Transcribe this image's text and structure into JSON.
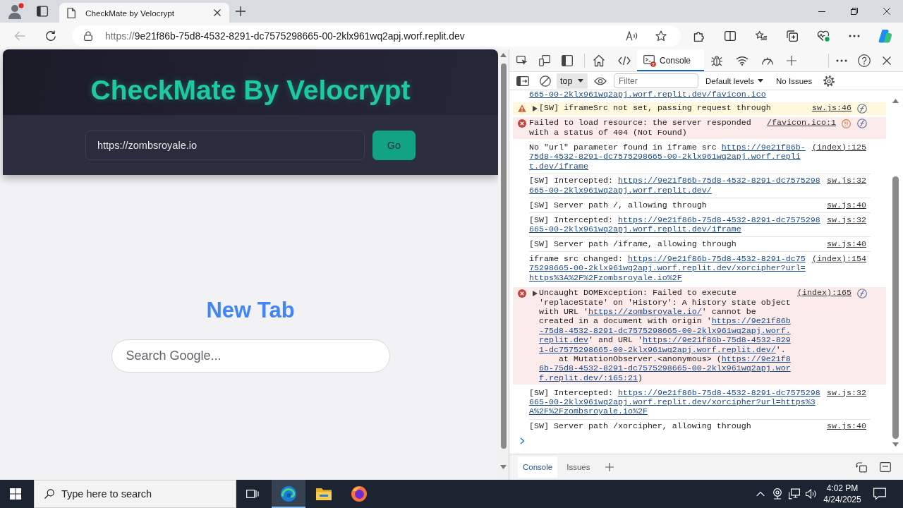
{
  "browser": {
    "tab": {
      "title": "CheckMate by Velocrypt"
    },
    "back_button": {
      "disabled": true
    },
    "address": {
      "scheme": "https://",
      "host": "9e21f86b-75d8-4532-8291-dc7575298665-00-2klx961wq2apj.worf.replit.dev"
    }
  },
  "page": {
    "title": "CheckMate By Velocrypt",
    "url_field": {
      "value": "https://zombsroyale.io"
    },
    "go_button": "Go",
    "heading": "New Tab",
    "search": {
      "placeholder": "Search Google..."
    }
  },
  "devtools": {
    "panel_tabs": [
      {
        "kind": "welcome",
        "selected": false
      },
      {
        "kind": "elements",
        "selected": false
      },
      {
        "kind": "console",
        "label": "Console",
        "selected": true
      },
      {
        "kind": "sources",
        "selected": false
      },
      {
        "kind": "network",
        "selected": false
      },
      {
        "kind": "performance",
        "selected": false
      }
    ],
    "context": "top",
    "filter": {
      "placeholder": "Filter"
    },
    "levels": "Default levels",
    "issues": "No Issues",
    "messages": [
      {
        "kind": "log",
        "expandable": false,
        "explain": false,
        "network": false,
        "segments": [
          {
            "kind": "link",
            "text": "665-00-2klx961wq2apj.worf.replit.dev/favicon.ico"
          }
        ]
      },
      {
        "kind": "warning",
        "expandable": true,
        "explain": true,
        "network": false,
        "segments": [
          {
            "kind": "text",
            "text": "[SW] iframeSrc not set, passing request through"
          }
        ],
        "source": "sw.js:46"
      },
      {
        "kind": "error",
        "expandable": false,
        "explain": true,
        "network": true,
        "segments": [
          {
            "kind": "text",
            "text": "Failed to load resource: the server responded with a status of 404 (Not Found)"
          }
        ],
        "source": "/favicon.ico:1"
      },
      {
        "kind": "log",
        "expandable": false,
        "explain": false,
        "network": false,
        "segments": [
          {
            "kind": "text",
            "text": "No \"url\" parameter found in iframe src "
          },
          {
            "kind": "link",
            "text": "https://9e21f86b-75d8-4532-8291-dc7575298665-00-2klx961wq2apj.worf.replit.dev/iframe"
          }
        ],
        "source": "(index):125"
      },
      {
        "kind": "log",
        "expandable": false,
        "explain": false,
        "network": false,
        "segments": [
          {
            "kind": "text",
            "text": "[SW] Intercepted: "
          },
          {
            "kind": "link",
            "text": "https://9e21f86b-75d8-4532-8291-dc7575298665-00-2klx961wq2apj.worf.replit.dev/"
          }
        ],
        "source": "sw.js:32"
      },
      {
        "kind": "log",
        "expandable": false,
        "explain": false,
        "network": false,
        "segments": [
          {
            "kind": "text",
            "text": "[SW] Server path /, allowing through"
          }
        ],
        "source": "sw.js:40"
      },
      {
        "kind": "log",
        "expandable": false,
        "explain": false,
        "network": false,
        "segments": [
          {
            "kind": "text",
            "text": "[SW] Intercepted: "
          },
          {
            "kind": "link",
            "text": "https://9e21f86b-75d8-4532-8291-dc7575298665-00-2klx961wq2apj.worf.replit.dev/iframe"
          }
        ],
        "source": "sw.js:32"
      },
      {
        "kind": "log",
        "expandable": false,
        "explain": false,
        "network": false,
        "segments": [
          {
            "kind": "text",
            "text": "[SW] Server path /iframe, allowing through"
          }
        ],
        "source": "sw.js:40"
      },
      {
        "kind": "log",
        "expandable": false,
        "explain": false,
        "network": false,
        "segments": [
          {
            "kind": "text",
            "text": "iframe src changed: "
          },
          {
            "kind": "link",
            "text": "https://9e21f86b-75d8-4532-8291-dc7575298665-00-2klx961wq2apj.worf.replit.dev/xorcipher?url=https%3A%2F%2Fzombsroyale.io%2F"
          }
        ],
        "source": "(index):154"
      },
      {
        "kind": "error",
        "expandable": true,
        "explain": true,
        "network": false,
        "segments": [
          {
            "kind": "text",
            "text": "Uncaught DOMException: Failed to execute 'replaceState' on 'History': A history state object with URL '"
          },
          {
            "kind": "link",
            "text": "https://zombsroyale.io/"
          },
          {
            "kind": "text",
            "text": "' cannot be created in a document with origin '"
          },
          {
            "kind": "link",
            "text": "https://9e21f86b-75d8-4532-8291-dc7575298665-00-2klx961wq2apj.worf.replit.dev"
          },
          {
            "kind": "text",
            "text": "' and URL '"
          },
          {
            "kind": "link",
            "text": "https://9e21f86b-75d8-4532-8291-dc7575298665-00-2klx961wq2apj.worf.replit.dev/"
          },
          {
            "kind": "text",
            "text": "'.\n    at MutationObserver.<anonymous> ("
          },
          {
            "kind": "link",
            "text": "https://9e21f86b-75d8-4532-8291-dc7575298665-00-2klx961wq2apj.worf.replit.dev/:165:21"
          },
          {
            "kind": "text",
            "text": ")"
          }
        ],
        "source": "(index):165"
      },
      {
        "kind": "log",
        "expandable": false,
        "explain": false,
        "network": false,
        "segments": [
          {
            "kind": "text",
            "text": "[SW] Intercepted: "
          },
          {
            "kind": "link",
            "text": "https://9e21f86b-75d8-4532-8291-dc7575298665-00-2klx961wq2apj.worf.replit.dev/xorcipher?url=https%3A%2F%2Fzombsroyale.io%2F"
          }
        ],
        "source": "sw.js:32"
      },
      {
        "kind": "log",
        "expandable": false,
        "explain": false,
        "network": false,
        "segments": [
          {
            "kind": "text",
            "text": "[SW] Server path /xorcipher, allowing through"
          }
        ],
        "source": "sw.js:40"
      }
    ],
    "drawer_tabs": [
      {
        "label": "Console",
        "selected": true
      },
      {
        "label": "Issues",
        "selected": false
      }
    ]
  },
  "taskbar": {
    "search": {
      "placeholder": "Type here to search"
    },
    "apps": [
      {
        "kind": "edge",
        "selected": true
      },
      {
        "kind": "explorer",
        "selected": false
      },
      {
        "kind": "firefox",
        "selected": false
      }
    ],
    "time": "4:02 PM",
    "date": "4/24/2025"
  }
}
